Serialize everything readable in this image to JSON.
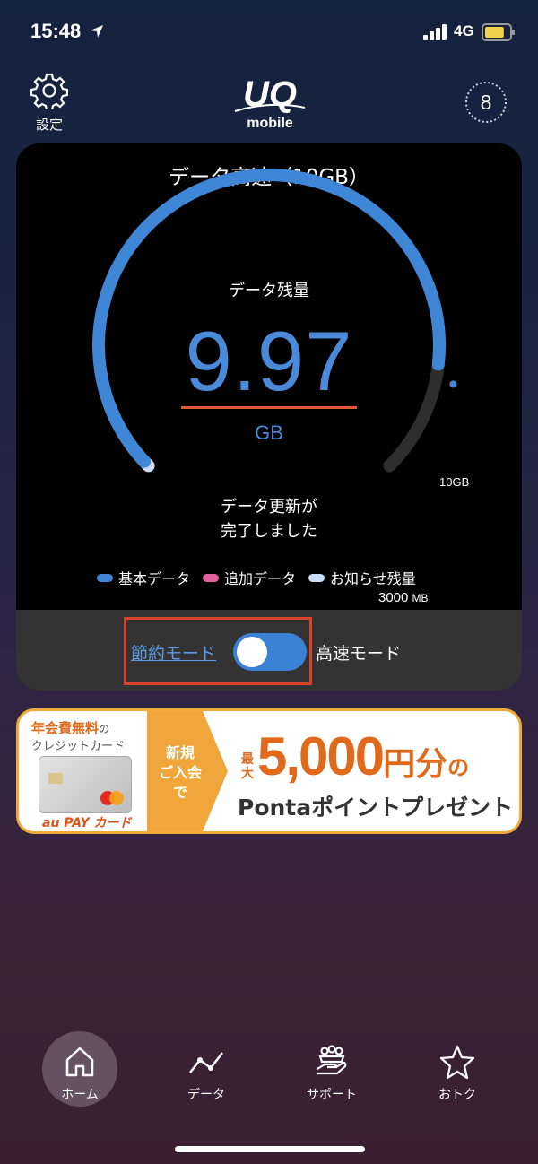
{
  "status_bar": {
    "time": "15:48",
    "network": "4G",
    "battery_level": 0.8,
    "battery_color": "#f3d34a"
  },
  "header": {
    "settings_icon": "gear-icon",
    "settings_label": "設定",
    "logo_text_top": "UQ",
    "logo_text_bottom": "mobile",
    "notification_count": "8"
  },
  "data_card": {
    "plan_title": "データ高速（10GB）",
    "remaining_label": "データ残量",
    "remaining_value": "9.97",
    "remaining_unit": "GB",
    "max_label": "10GB",
    "update_status_line1": "データ更新が",
    "update_status_line2": "完了しました",
    "gauge": {
      "capacity_gb": 10,
      "basic_gb": 9.97,
      "notify_gb": 3,
      "track_color": "#2e2e2e",
      "basic_color": "#3f86d6",
      "notify_color": "#c9def4"
    },
    "legend": [
      {
        "label": "基本データ",
        "color": "#3f86d6"
      },
      {
        "label": "追加データ",
        "color": "#e0609c"
      },
      {
        "label": "お知らせ残量",
        "color": "#c9def4"
      }
    ],
    "notify_amount": "3000",
    "notify_unit": "MB"
  },
  "mode_switch": {
    "saving_label": "節約モード",
    "fast_label": "高速モード",
    "fast_mode_on": true
  },
  "promo": {
    "annual_fee": "年会費無料",
    "annual_fee_suffix": "の",
    "card_type": "クレジットカード",
    "card_brand": "au PAY カード",
    "new_line1": "新規",
    "new_line2": "ご入会で",
    "max": "最大",
    "amount": "5,000",
    "yen_part": "円分",
    "no": "の",
    "ponta_text": "Pontaポイントプレゼント"
  },
  "tab_bar": [
    {
      "label": "ホーム",
      "icon": "home-icon",
      "active": true
    },
    {
      "label": "データ",
      "icon": "chart-line-icon",
      "active": false
    },
    {
      "label": "サポート",
      "icon": "support-hand-icon",
      "active": false
    },
    {
      "label": "おトク",
      "icon": "star-icon",
      "active": false
    }
  ]
}
